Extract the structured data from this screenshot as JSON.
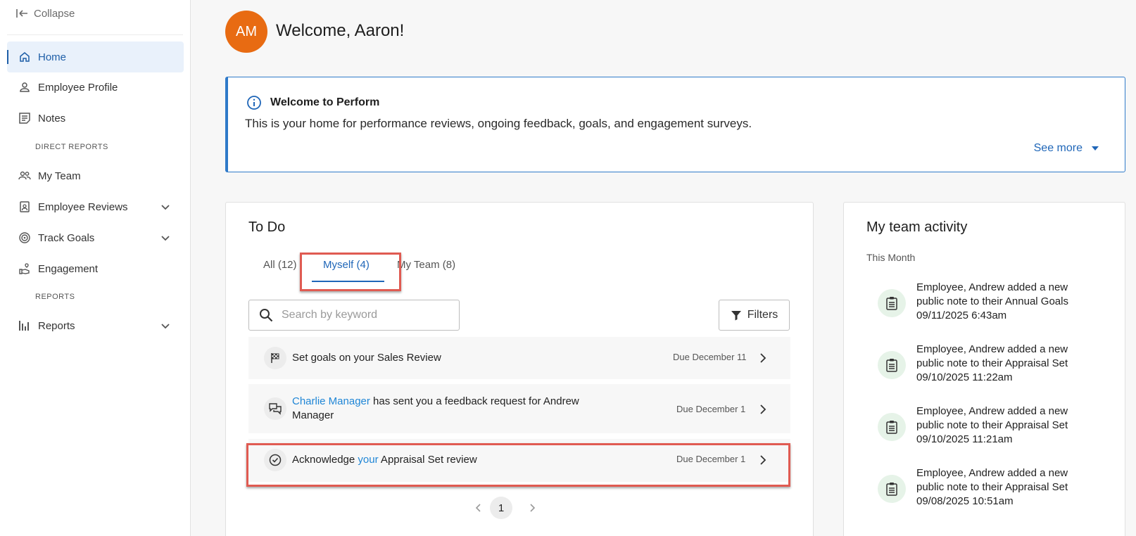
{
  "sidebar": {
    "collapse_label": "Collapse",
    "items": [
      {
        "label": "Home"
      },
      {
        "label": "Employee Profile"
      },
      {
        "label": "Notes"
      },
      {
        "label": "My Team"
      },
      {
        "label": "Employee Reviews"
      },
      {
        "label": "Track Goals"
      },
      {
        "label": "Engagement"
      },
      {
        "label": "Reports"
      }
    ],
    "section_direct_reports": "DIRECT REPORTS",
    "section_reports": "REPORTS"
  },
  "header": {
    "avatar_initials": "AM",
    "welcome": "Welcome, Aaron!"
  },
  "banner": {
    "title": "Welcome to Perform",
    "text": "This is your home for performance reviews, ongoing feedback, goals, and engagement surveys.",
    "see_more": "See more"
  },
  "todo": {
    "title": "To Do",
    "tabs": [
      {
        "label": "All (12)"
      },
      {
        "label": "Myself (4)"
      },
      {
        "label": "My Team (8)"
      }
    ],
    "search_placeholder": "Search by keyword",
    "filters_label": "Filters",
    "tasks": [
      {
        "text": "Set goals on your Sales Review",
        "due": "Due December 11",
        "icon": "flag-icon"
      },
      {
        "link": "Charlie Manager",
        "text": " has sent you a feedback request for Andrew Manager",
        "due": "Due December 1",
        "icon": "feedback-icon"
      },
      {
        "prefix": "Acknowledge ",
        "link": "your",
        "text": " Appraisal Set review",
        "due": "Due December 1",
        "icon": "check-circle-icon"
      }
    ],
    "current_page": "1"
  },
  "activity": {
    "title": "My team activity",
    "subtitle": "This Month",
    "items": [
      {
        "line1": "Employee, Andrew added a new",
        "line2": "public note to their Annual Goals",
        "time": "09/11/2025 6:43am"
      },
      {
        "line1": "Employee, Andrew added a new",
        "line2": "public note to their Appraisal Set",
        "time": "09/10/2025 11:22am"
      },
      {
        "line1": "Employee, Andrew added a new",
        "line2": "public note to their Appraisal Set",
        "time": "09/10/2025 11:21am"
      },
      {
        "line1": "Employee, Andrew added a new",
        "line2": "public note to their Appraisal Set",
        "time": "09/08/2025 10:51am"
      }
    ]
  },
  "colors": {
    "accent": "#1f66b8",
    "avatar": "#e86b12",
    "highlight": "#e05b52"
  }
}
